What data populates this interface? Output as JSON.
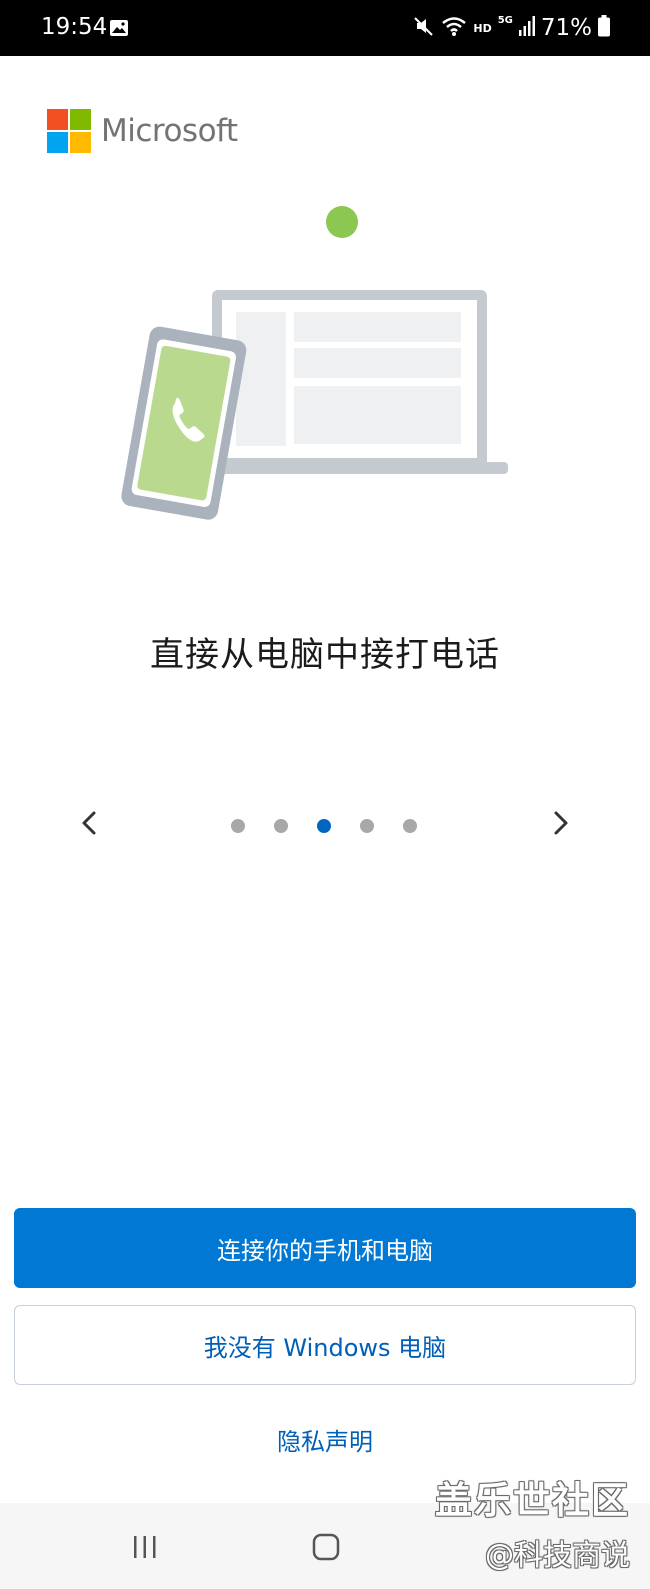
{
  "status_bar": {
    "time": "19:54",
    "network_hd": "HD",
    "network_5g": "5G",
    "battery": "71%",
    "icons": [
      "gallery-icon",
      "mute-icon",
      "wifi-icon",
      "signal-icon",
      "battery-icon"
    ]
  },
  "brand": {
    "name": "Microsoft",
    "colors": {
      "red": "#f25022",
      "green": "#7fba00",
      "blue": "#00a4ef",
      "yellow": "#ffb900"
    }
  },
  "slide": {
    "title": "直接从电脑中接打电话",
    "illustration_icon": "phone-call-icon"
  },
  "pager": {
    "total": 5,
    "active_index": 2
  },
  "actions": {
    "connect_label": "连接你的手机和电脑",
    "no_windows_label": "我没有 Windows 电脑",
    "privacy_label": "隐私声明"
  },
  "watermark": {
    "line1": "盖乐世社区",
    "line2": "@科技商说"
  },
  "colors": {
    "primary": "#0078d4",
    "link": "#005fb8",
    "dot_inactive": "#a8a8a8",
    "dot_active": "#0067c0",
    "phone_screen": "#b9d98e",
    "accent_dot": "#8cc751"
  }
}
